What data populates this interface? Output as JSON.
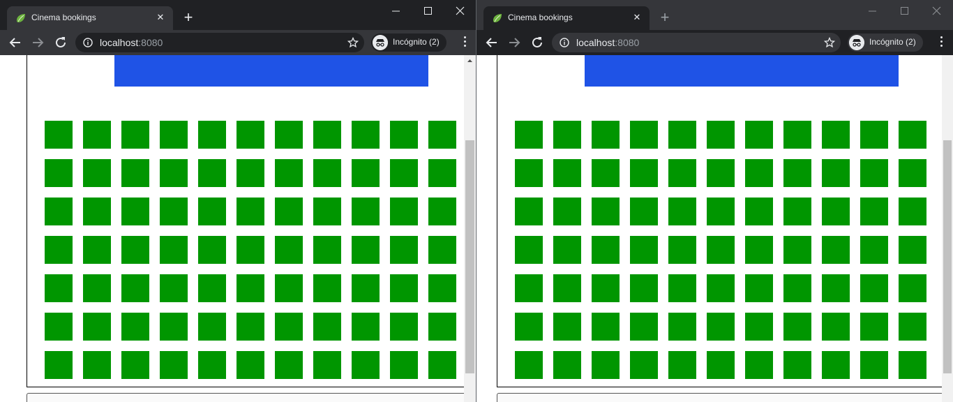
{
  "windows": [
    {
      "id": "left",
      "tab": {
        "title": "Cinema bookings",
        "close_label": "✕"
      },
      "new_tab_label": "+",
      "address": {
        "host": "localhost",
        "port": ":8080"
      },
      "incognito_label": "Incógnito (2)",
      "seat_rows": 7,
      "seat_cols": 11
    },
    {
      "id": "right",
      "tab": {
        "title": "Cinema bookings",
        "close_label": "✕"
      },
      "new_tab_label": "+",
      "address": {
        "host": "localhost",
        "port": ":8080"
      },
      "incognito_label": "Incógnito (2)",
      "seat_rows": 7,
      "seat_cols": 11
    }
  ],
  "colors": {
    "screen": "#1f53e6",
    "seat_available": "#009600"
  },
  "icons": [
    "spring-leaf-favicon-icon",
    "close-icon",
    "plus-icon",
    "back-arrow-icon",
    "forward-arrow-icon",
    "reload-icon",
    "info-icon",
    "star-icon",
    "incognito-icon",
    "more-vert-icon",
    "minimize-icon",
    "maximize-icon",
    "window-close-icon"
  ]
}
